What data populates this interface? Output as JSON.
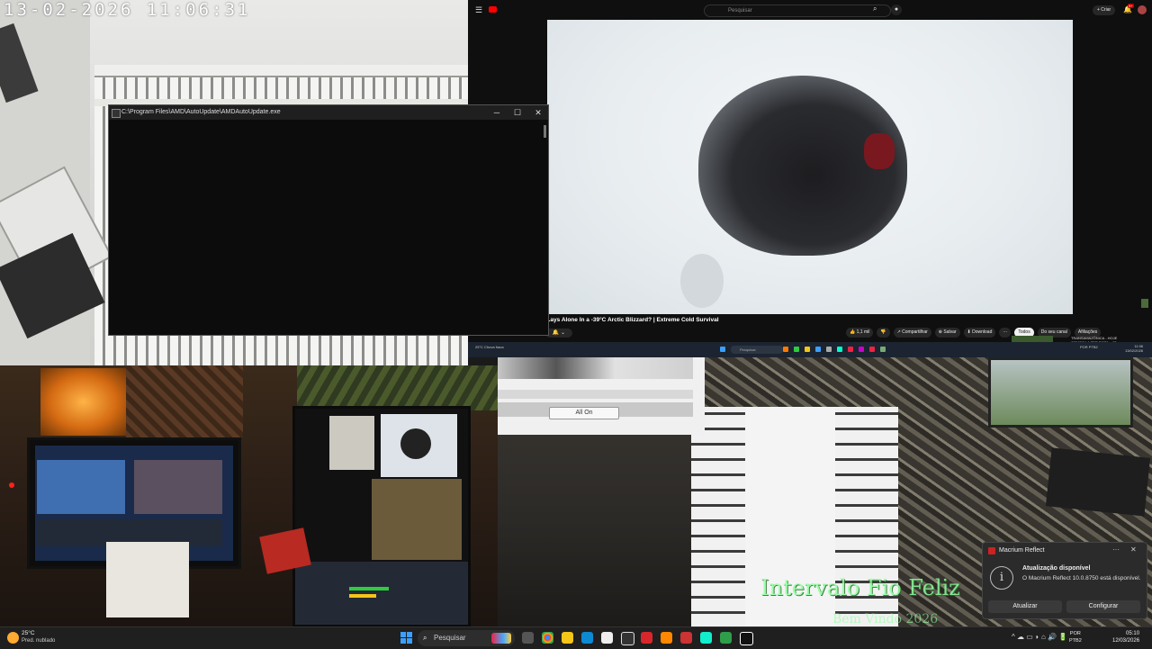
{
  "camera_top_left": {
    "timestamp": "13-02-2026 11:06:31"
  },
  "console": {
    "title": "C:\\Program Files\\AMD\\AutoUpdate\\AMDAutoUpdate.exe",
    "minimize": "─",
    "maximize": "☐",
    "close": "✕"
  },
  "youtube": {
    "menu_icon": "☰",
    "search_placeholder": "Pesquisar",
    "create_label": "+ Criar",
    "notifications_badge": "9+",
    "video_title": "...ays Alone In a -39°C Arctic Blizzard? | Extreme Cold Survival",
    "actions": [
      "👍 1,1 mil",
      "👎",
      "↗ Compartilhar",
      "⊕ Salvar",
      "⬇ Download",
      "···"
    ],
    "filter_chips": [
      "Todos",
      "Do seu canal",
      "Afiliações"
    ],
    "side_video_title": "TRANSAMAZÔNICA - HOJE",
    "side_video_sub": "COMECA A TER ROTA... 63"
  },
  "mini_taskbar": {
    "weather": "25°C Chuva fraca",
    "search": "Pesquisar",
    "clock_time": "11:06",
    "clock_date": "13/02/2026",
    "lang": "POR PTB2"
  },
  "allon_panel": {
    "button_label": "All On"
  },
  "overlay_text": {
    "line1": "Intervalo Fio Feliz",
    "line2": "Bem Vindo 2026"
  },
  "toast": {
    "app_name": "Macrium Reflect",
    "title": "Atualização disponível",
    "body": "O Macrium Reflect 10.0.8750 está disponível.",
    "update_button": "Atualizar",
    "configure_button": "Configurar",
    "more": "···",
    "close": "✕"
  },
  "taskbar": {
    "weather_temp": "25°C",
    "weather_desc": "Pred. nublado",
    "search_label": "Pesquisar",
    "lang_line1": "POR",
    "lang_line2": "PTB2",
    "time": "05:10",
    "date": "12/03/2026",
    "tray_icons": "^ ☁ ▭ ◗ ⌂ 🔊 🔋"
  }
}
